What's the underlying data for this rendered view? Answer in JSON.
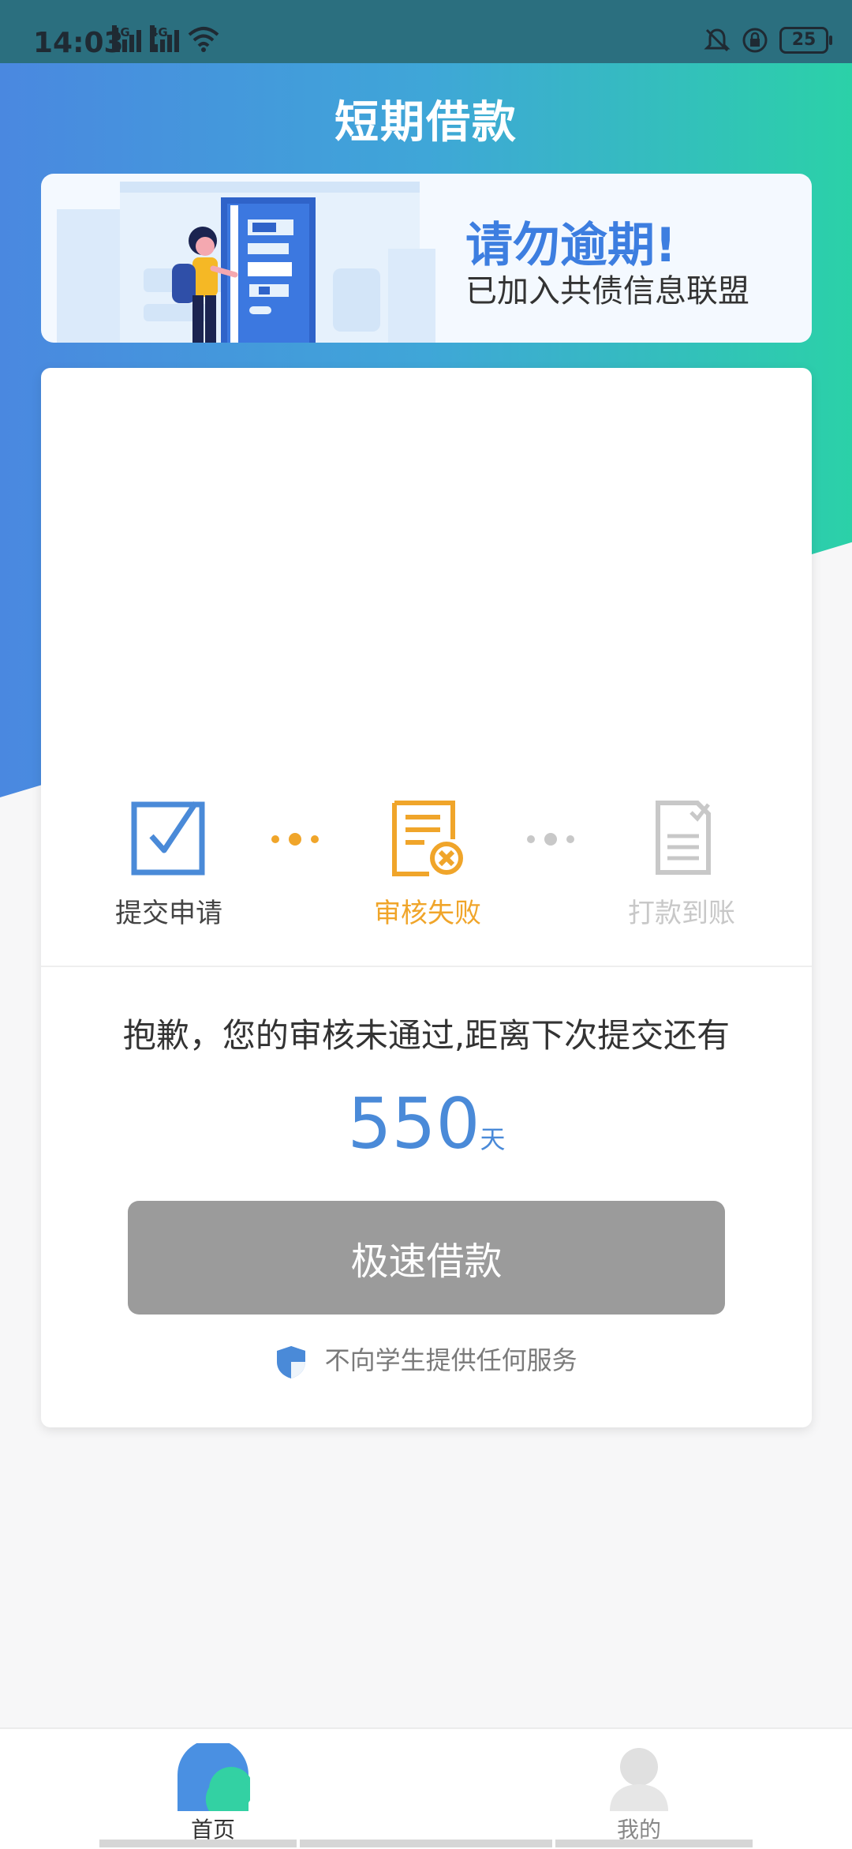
{
  "status_bar": {
    "time": "14:03",
    "network_1": "4G",
    "network_2": "4G",
    "battery": "25"
  },
  "header": {
    "title": "短期借款"
  },
  "banner": {
    "title": "请勿逾期!",
    "subtitle": "已加入共债信息联盟"
  },
  "steps": [
    {
      "label": "提交申请",
      "state": "done",
      "color": "#4a8ad8"
    },
    {
      "label": "审核失败",
      "state": "failed",
      "color": "#f0a52a"
    },
    {
      "label": "打款到账",
      "state": "pending",
      "color": "#c8c8c8"
    }
  ],
  "result": {
    "message": "抱歉，您的审核未通过,距离下次提交还有",
    "days": "550",
    "days_unit": "天"
  },
  "action": {
    "button_label": "极速借款"
  },
  "notice": {
    "text": "不向学生提供任何服务"
  },
  "tabbar": {
    "tabs": [
      {
        "label": "首页",
        "active": true
      },
      {
        "label": "我的",
        "active": false
      }
    ]
  },
  "colors": {
    "accent_blue": "#4a8ad8",
    "accent_orange": "#f0a52a",
    "inactive_gray": "#c8c8c8",
    "header_gradient_start": "#4a88e0",
    "header_gradient_end": "#2bd1a8"
  }
}
